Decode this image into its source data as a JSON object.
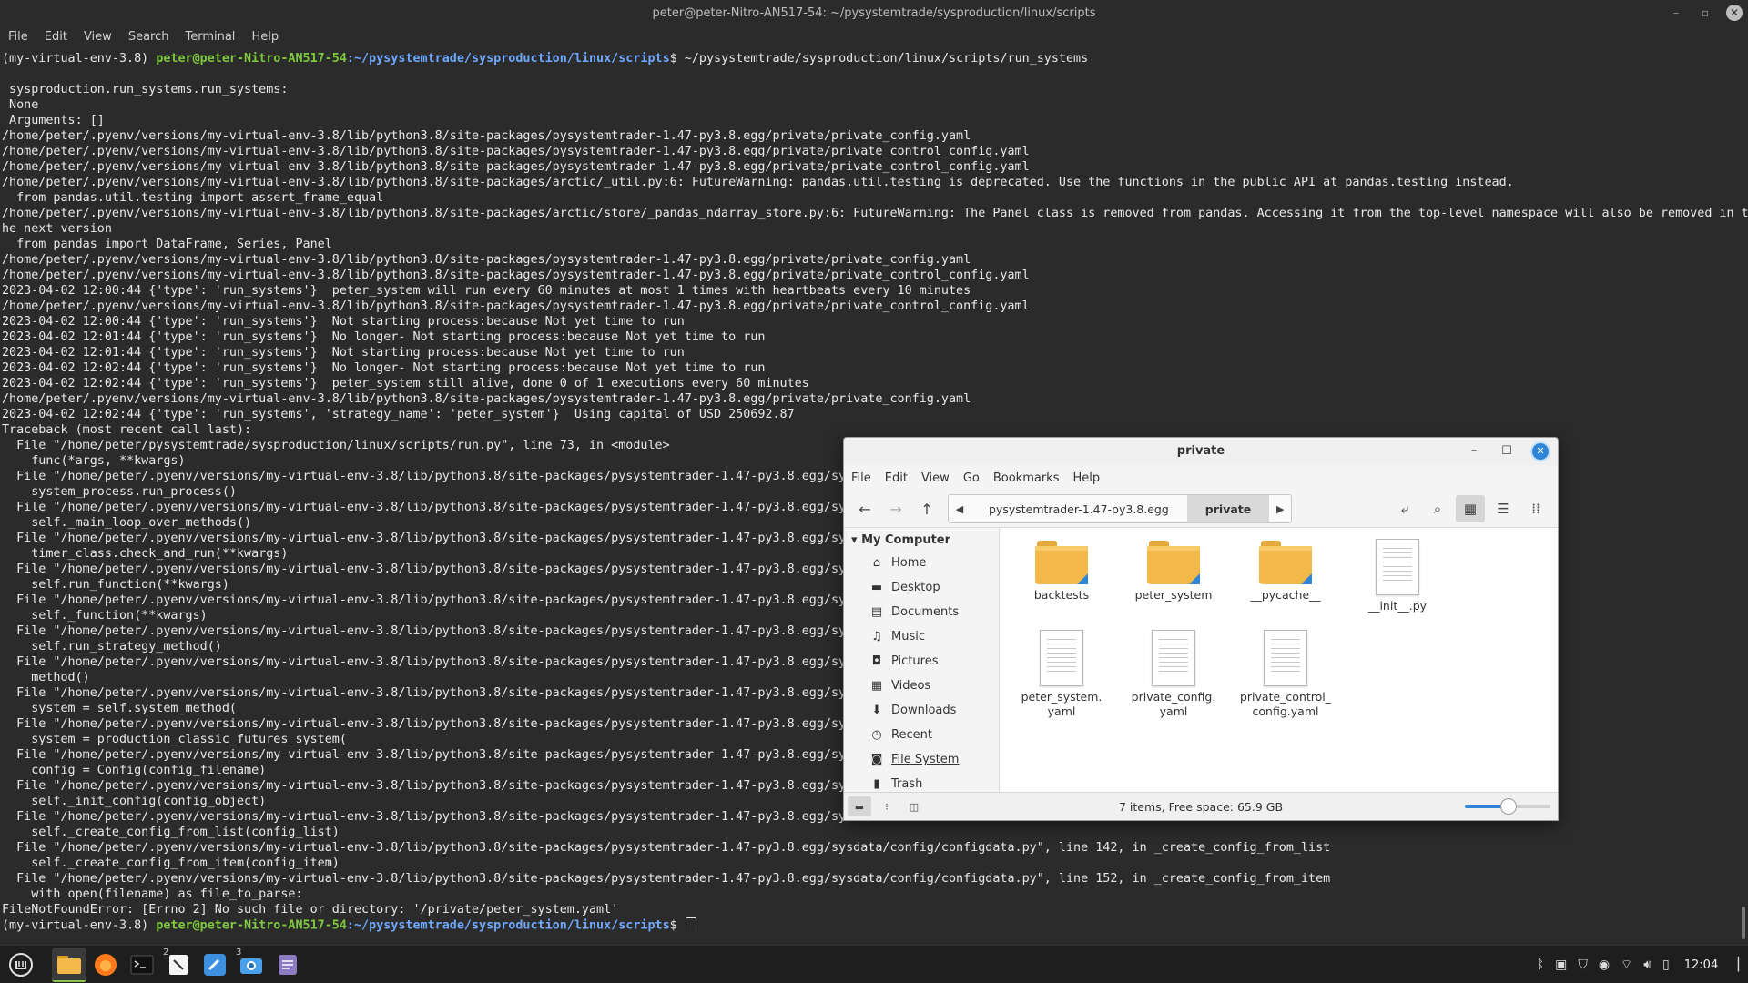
{
  "terminal": {
    "title": "peter@peter-Nitro-AN517-54: ~/pysystemtrade/sysproduction/linux/scripts",
    "menu": [
      "File",
      "Edit",
      "View",
      "Search",
      "Terminal",
      "Help"
    ],
    "prompt_env": "(my-virtual-env-3.8) ",
    "prompt_user": "peter@peter-Nitro-AN517-54",
    "prompt_path": ":~/pysystemtrade/sysproduction/linux/scripts",
    "prompt_suffix": "$ ",
    "first_command": "~/pysystemtrade/sysproduction/linux/scripts/run_systems",
    "lines": [
      "",
      " sysproduction.run_systems.run_systems:",
      " None",
      " Arguments: []",
      "/home/peter/.pyenv/versions/my-virtual-env-3.8/lib/python3.8/site-packages/pysystemtrader-1.47-py3.8.egg/private/private_config.yaml",
      "/home/peter/.pyenv/versions/my-virtual-env-3.8/lib/python3.8/site-packages/pysystemtrader-1.47-py3.8.egg/private/private_control_config.yaml",
      "/home/peter/.pyenv/versions/my-virtual-env-3.8/lib/python3.8/site-packages/pysystemtrader-1.47-py3.8.egg/private/private_control_config.yaml",
      "/home/peter/.pyenv/versions/my-virtual-env-3.8/lib/python3.8/site-packages/arctic/_util.py:6: FutureWarning: pandas.util.testing is deprecated. Use the functions in the public API at pandas.testing instead.",
      "  from pandas.util.testing import assert_frame_equal",
      "/home/peter/.pyenv/versions/my-virtual-env-3.8/lib/python3.8/site-packages/arctic/store/_pandas_ndarray_store.py:6: FutureWarning: The Panel class is removed from pandas. Accessing it from the top-level namespace will also be removed in t",
      "he next version",
      "  from pandas import DataFrame, Series, Panel",
      "/home/peter/.pyenv/versions/my-virtual-env-3.8/lib/python3.8/site-packages/pysystemtrader-1.47-py3.8.egg/private/private_config.yaml",
      "/home/peter/.pyenv/versions/my-virtual-env-3.8/lib/python3.8/site-packages/pysystemtrader-1.47-py3.8.egg/private/private_control_config.yaml",
      "2023-04-02 12:00:44 {'type': 'run_systems'}  peter_system will run every 60 minutes at most 1 times with heartbeats every 10 minutes",
      "/home/peter/.pyenv/versions/my-virtual-env-3.8/lib/python3.8/site-packages/pysystemtrader-1.47-py3.8.egg/private/private_control_config.yaml",
      "2023-04-02 12:00:44 {'type': 'run_systems'}  Not starting process:because Not yet time to run",
      "2023-04-02 12:01:44 {'type': 'run_systems'}  No longer- Not starting process:because Not yet time to run",
      "2023-04-02 12:01:44 {'type': 'run_systems'}  Not starting process:because Not yet time to run",
      "2023-04-02 12:02:44 {'type': 'run_systems'}  No longer- Not starting process:because Not yet time to run",
      "2023-04-02 12:02:44 {'type': 'run_systems'}  peter_system still alive, done 0 of 1 executions every 60 minutes",
      "/home/peter/.pyenv/versions/my-virtual-env-3.8/lib/python3.8/site-packages/pysystemtrader-1.47-py3.8.egg/private/private_config.yaml",
      "2023-04-02 12:02:44 {'type': 'run_systems', 'strategy_name': 'peter_system'}  Using capital of USD 250692.87",
      "Traceback (most recent call last):",
      "  File \"/home/peter/pysystemtrade/sysproduction/linux/scripts/run.py\", line 73, in <module>",
      "    func(*args, **kwargs)",
      "  File \"/home/peter/.pyenv/versions/my-virtual-env-3.8/lib/python3.8/site-packages/pysystemtrader-1.47-py3.8.egg/sys",
      "    system_process.run_process()",
      "  File \"/home/peter/.pyenv/versions/my-virtual-env-3.8/lib/python3.8/site-packages/pysystemtrader-1.47-py3.8.egg/sys",
      "    self._main_loop_over_methods()",
      "  File \"/home/peter/.pyenv/versions/my-virtual-env-3.8/lib/python3.8/site-packages/pysystemtrader-1.47-py3.8.egg/sys",
      "    timer_class.check_and_run(**kwargs)",
      "  File \"/home/peter/.pyenv/versions/my-virtual-env-3.8/lib/python3.8/site-packages/pysystemtrader-1.47-py3.8.egg/sys",
      "    self.run_function(**kwargs)",
      "  File \"/home/peter/.pyenv/versions/my-virtual-env-3.8/lib/python3.8/site-packages/pysystemtrader-1.47-py3.8.egg/sys",
      "    self._function(**kwargs)",
      "  File \"/home/peter/.pyenv/versions/my-virtual-env-3.8/lib/python3.8/site-packages/pysystemtrader-1.47-py3.8.egg/sys",
      "    self.run_strategy_method()",
      "  File \"/home/peter/.pyenv/versions/my-virtual-env-3.8/lib/python3.8/site-packages/pysystemtrader-1.47-py3.8.egg/sys",
      "    method()",
      "  File \"/home/peter/.pyenv/versions/my-virtual-env-3.8/lib/python3.8/site-packages/pysystemtrader-1.47-py3.8.egg/sys",
      "    system = self.system_method(",
      "  File \"/home/peter/.pyenv/versions/my-virtual-env-3.8/lib/python3.8/site-packages/pysystemtrader-1.47-py3.8.egg/sys",
      "    system = production_classic_futures_system(",
      "  File \"/home/peter/.pyenv/versions/my-virtual-env-3.8/lib/python3.8/site-packages/pysystemtrader-1.47-py3.8.egg/sys",
      "    config = Config(config_filename)",
      "  File \"/home/peter/.pyenv/versions/my-virtual-env-3.8/lib/python3.8/site-packages/pysystemtrader-1.47-py3.8.egg/sys",
      "    self._init_config(config_object)",
      "  File \"/home/peter/.pyenv/versions/my-virtual-env-3.8/lib/python3.8/site-packages/pysystemtrader-1.47-py3.8.egg/sys",
      "    self._create_config_from_list(config_list)",
      "  File \"/home/peter/.pyenv/versions/my-virtual-env-3.8/lib/python3.8/site-packages/pysystemtrader-1.47-py3.8.egg/sysdata/config/configdata.py\", line 142, in _create_config_from_list",
      "    self._create_config_from_item(config_item)",
      "  File \"/home/peter/.pyenv/versions/my-virtual-env-3.8/lib/python3.8/site-packages/pysystemtrader-1.47-py3.8.egg/sysdata/config/configdata.py\", line 152, in _create_config_from_item",
      "    with open(filename) as file_to_parse:",
      "FileNotFoundError: [Errno 2] No such file or directory: '/private/peter_system.yaml'"
    ]
  },
  "file_manager": {
    "title": "private",
    "menu": [
      "File",
      "Edit",
      "View",
      "Go",
      "Bookmarks",
      "Help"
    ],
    "breadcrumb": [
      "pysystemtrader-1.47-py3.8.egg",
      "private"
    ],
    "sidebar_header": "My Computer",
    "sidebar": [
      {
        "label": "Home",
        "icon": "home-icon",
        "glyph": "⌂"
      },
      {
        "label": "Desktop",
        "icon": "desktop-icon",
        "glyph": "▬"
      },
      {
        "label": "Documents",
        "icon": "documents-icon",
        "glyph": "▤"
      },
      {
        "label": "Music",
        "icon": "music-icon",
        "glyph": "♫"
      },
      {
        "label": "Pictures",
        "icon": "pictures-icon",
        "glyph": "◘"
      },
      {
        "label": "Videos",
        "icon": "videos-icon",
        "glyph": "▦"
      },
      {
        "label": "Downloads",
        "icon": "downloads-icon",
        "glyph": "⬇"
      },
      {
        "label": "Recent",
        "icon": "recent-icon",
        "glyph": "◷"
      },
      {
        "label": "File System",
        "icon": "filesystem-icon",
        "glyph": "◙"
      },
      {
        "label": "Trash",
        "icon": "trash-icon",
        "glyph": "▮"
      }
    ],
    "files": [
      {
        "name": "backtests",
        "type": "folder"
      },
      {
        "name": "peter_system",
        "type": "folder"
      },
      {
        "name": "__pycache__",
        "type": "folder"
      },
      {
        "name": "__init__.py",
        "type": "file"
      },
      {
        "name": "peter_system.\nyaml",
        "type": "file"
      },
      {
        "name": "private_config.\nyaml",
        "type": "file"
      },
      {
        "name": "private_control_\nconfig.yaml",
        "type": "file"
      }
    ],
    "status": "7 items, Free space: 65.9 GB",
    "zoom_level": 0.5
  },
  "taskbar": {
    "clock": "12:04",
    "badges": {
      "files": "2",
      "screenshot": "3"
    }
  },
  "colors": {
    "terminal_bg": "#2b2b2b",
    "prompt_user": "#7ec93d",
    "prompt_path": "#6ea9ff",
    "accent": "#2f86d6",
    "folder": "#f2b84a"
  }
}
